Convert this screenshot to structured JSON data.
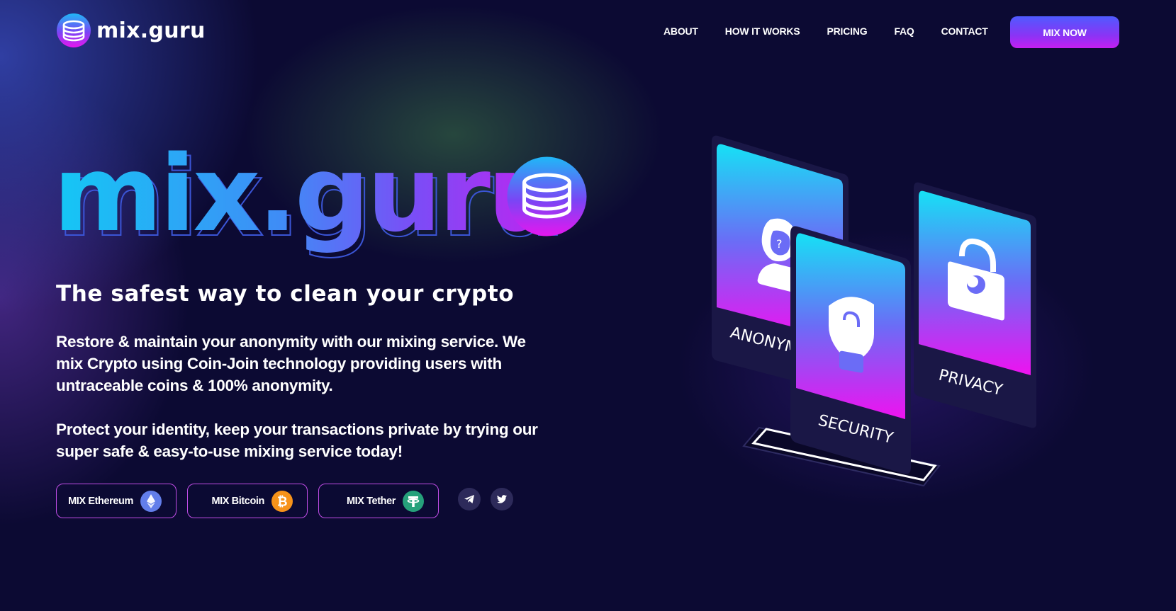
{
  "header": {
    "brand": "mix.guru",
    "nav": [
      {
        "label": "ABOUT"
      },
      {
        "label": "HOW IT WORKS"
      },
      {
        "label": "PRICING"
      },
      {
        "label": "FAQ"
      },
      {
        "label": "CONTACT"
      }
    ],
    "cta_label": "MIX NOW"
  },
  "hero": {
    "title": "mix.guru",
    "tagline": "The safest way to clean your crypto",
    "paragraph1": "Restore & maintain your anonymity with our mixing service. We mix Crypto using Coin-Join technology providing users with untraceable coins & 100% anonymity.",
    "paragraph2": "Protect your identity, keep your transactions private by trying our super safe & easy-to-use mixing service today!",
    "buttons": [
      {
        "label": "MIX Ethereum",
        "icon": "ethereum-icon"
      },
      {
        "label": "MIX Bitcoin",
        "icon": "bitcoin-icon"
      },
      {
        "label": "MIX Tether",
        "icon": "tether-icon"
      }
    ],
    "social": [
      {
        "icon": "telegram-icon"
      },
      {
        "icon": "twitter-icon"
      }
    ]
  },
  "illustration": {
    "cards": [
      {
        "label": "ANONYMITY",
        "icon": "anonymous-user-icon"
      },
      {
        "label": "SECURITY",
        "icon": "shield-lock-icon"
      },
      {
        "label": "PRIVACY",
        "icon": "padlock-eye-icon"
      }
    ]
  },
  "colors": {
    "background": "#0c0a33",
    "accent_blue": "#17c6f5",
    "accent_purple": "#8a34f5",
    "accent_magenta": "#e515f0",
    "pill_border": "#c04de6",
    "ethereum": "#627eea",
    "bitcoin": "#f7931a",
    "tether": "#26a17b"
  }
}
